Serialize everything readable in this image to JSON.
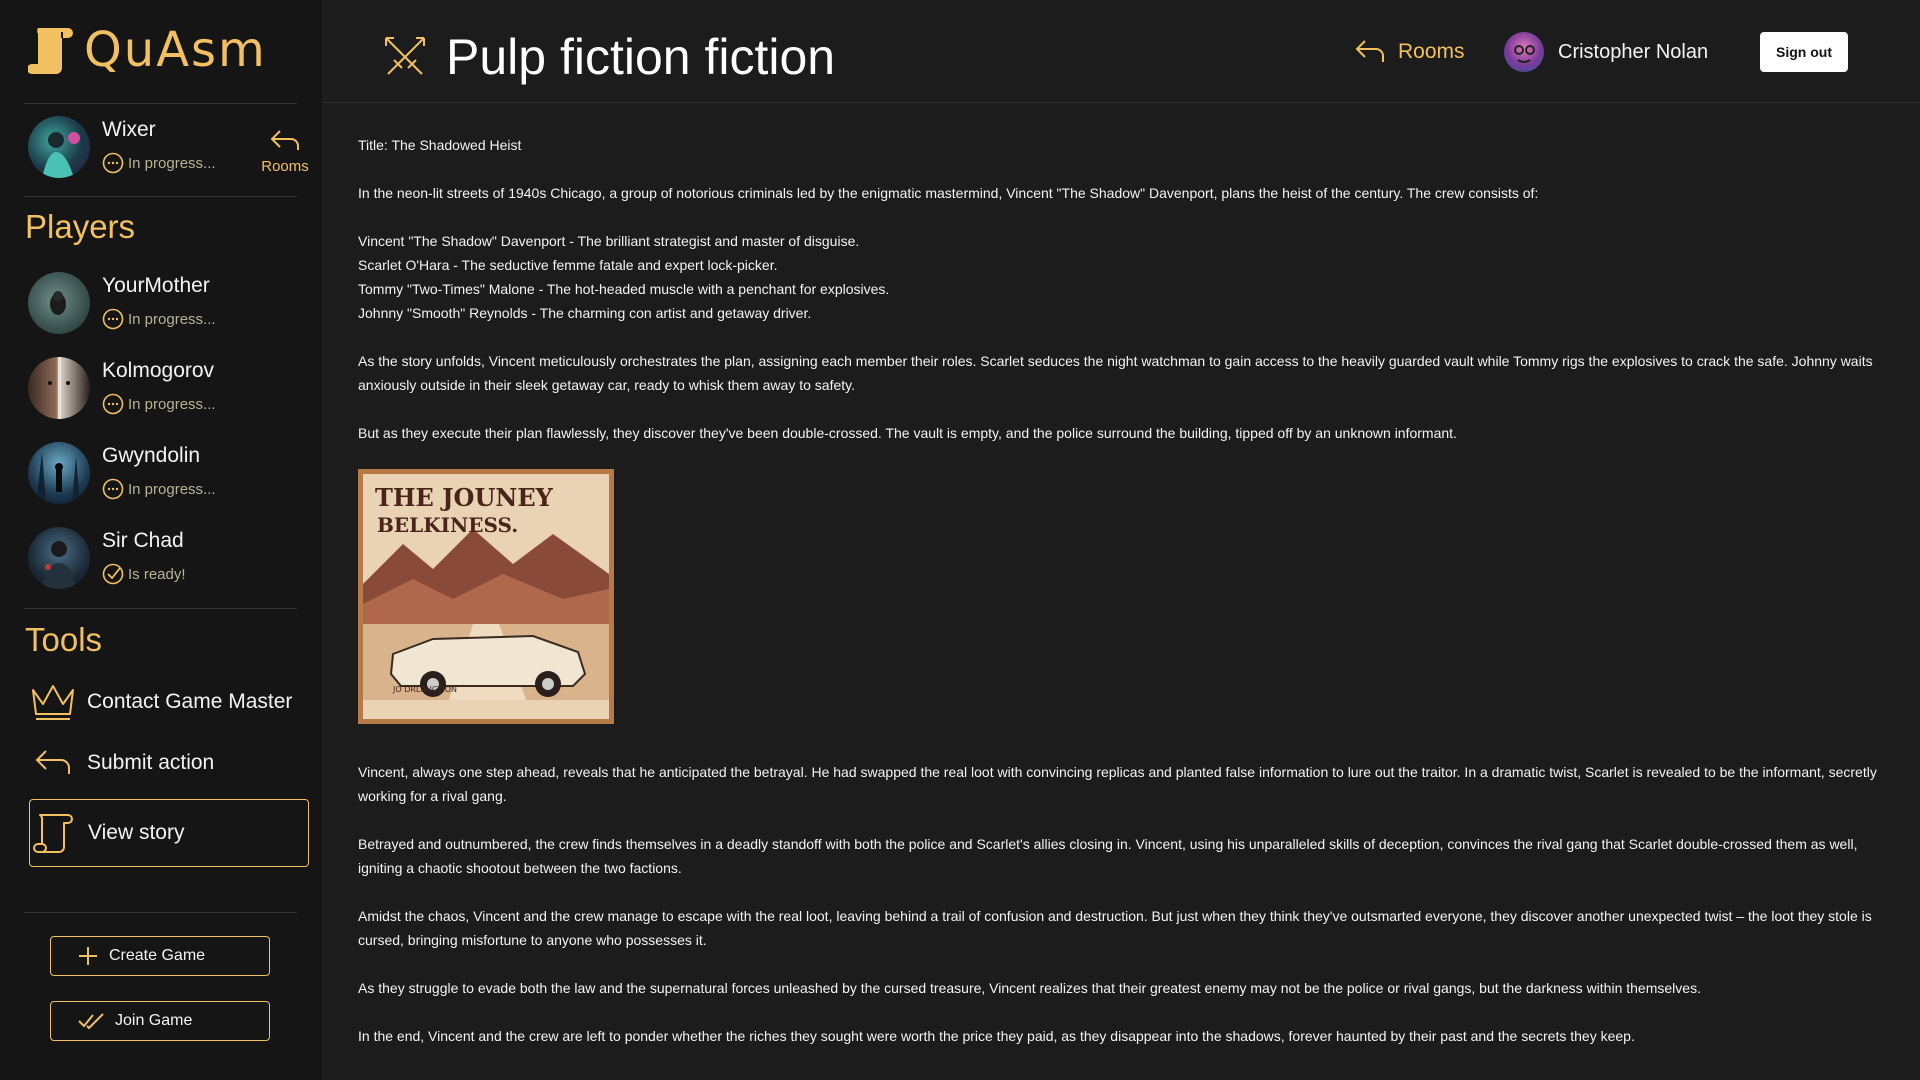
{
  "app": {
    "logo_text": "QuAsm"
  },
  "header": {
    "title": "Pulp fiction fiction",
    "rooms_label": "Rooms",
    "user_name": "Cristopher Nolan",
    "signout_label": "Sign out"
  },
  "sidebar": {
    "current_player": {
      "name": "Wixer",
      "status": "In progress..."
    },
    "rooms_label": "Rooms",
    "players_title": "Players",
    "players": [
      {
        "name": "YourMother",
        "status": "In progress...",
        "state": "progress"
      },
      {
        "name": "Kolmogorov",
        "status": "In progress...",
        "state": "progress"
      },
      {
        "name": "Gwyndolin",
        "status": "In progress...",
        "state": "progress"
      },
      {
        "name": "Sir Chad",
        "status": "Is ready!",
        "state": "ready"
      }
    ],
    "tools_title": "Tools",
    "tools": [
      {
        "label": "Contact Game Master",
        "icon": "crown-icon"
      },
      {
        "label": "Submit action",
        "icon": "return-arrow-icon"
      },
      {
        "label": "View story",
        "icon": "scroll-icon",
        "active": true
      }
    ],
    "create_game_label": "Create Game",
    "join_game_label": "Join Game"
  },
  "story": {
    "title_line": "Title: The Shadowed Heist",
    "intro": "In the neon-lit streets of 1940s Chicago, a group of notorious criminals led by the enigmatic mastermind, Vincent \"The Shadow\" Davenport, plans the heist of the century. The crew consists of:",
    "crew": [
      "Vincent \"The Shadow\" Davenport - The brilliant strategist and master of disguise.",
      "Scarlet O'Hara - The seductive femme fatale and expert lock-picker.",
      "Tommy \"Two-Times\" Malone - The hot-headed muscle with a penchant for explosives.",
      "Johnny \"Smooth\" Reynolds - The charming con artist and getaway driver."
    ],
    "p1": "As the story unfolds, Vincent meticulously orchestrates the plan, assigning each member their roles. Scarlet seduces the night watchman to gain access to the heavily guarded vault while Tommy rigs the explosives to crack the safe. Johnny waits anxiously outside in their sleek getaway car, ready to whisk them away to safety.",
    "p2": "But as they execute their plan flawlessly, they discover they've been double-crossed. The vault is empty, and the police surround the building, tipped off by an unknown informant.",
    "poster": {
      "headline_1": "THE JOUNEY",
      "headline_2": "BELKINESS.",
      "footer": "JO DRLAUCTION"
    },
    "p3": "Vincent, always one step ahead, reveals that he anticipated the betrayal. He had swapped the real loot with convincing replicas and planted false information to lure out the traitor. In a dramatic twist, Scarlet is revealed to be the informant, secretly working for a rival gang.",
    "p4": "Betrayed and outnumbered, the crew finds themselves in a deadly standoff with both the police and Scarlet's allies closing in. Vincent, using his unparalleled skills of deception, convinces the rival gang that Scarlet double-crossed them as well, igniting a chaotic shootout between the two factions.",
    "p5": "Amidst the chaos, Vincent and the crew manage to escape with the real loot, leaving behind a trail of confusion and destruction. But just when they think they've outsmarted everyone, they discover another unexpected twist – the loot they stole is cursed, bringing misfortune to anyone who possesses it.",
    "p6": "As they struggle to evade both the law and the supernatural forces unleashed by the cursed treasure, Vincent realizes that their greatest enemy may not be the police or rival gangs, but the darkness within themselves.",
    "p7": "In the end, Vincent and the crew are left to ponder whether the riches they sought were worth the price they paid, as they disappear into the shadows, forever haunted by their past and the secrets they keep."
  },
  "colors": {
    "accent": "#f2c061",
    "background": "#1c1c1c",
    "sidebar": "#151515"
  }
}
